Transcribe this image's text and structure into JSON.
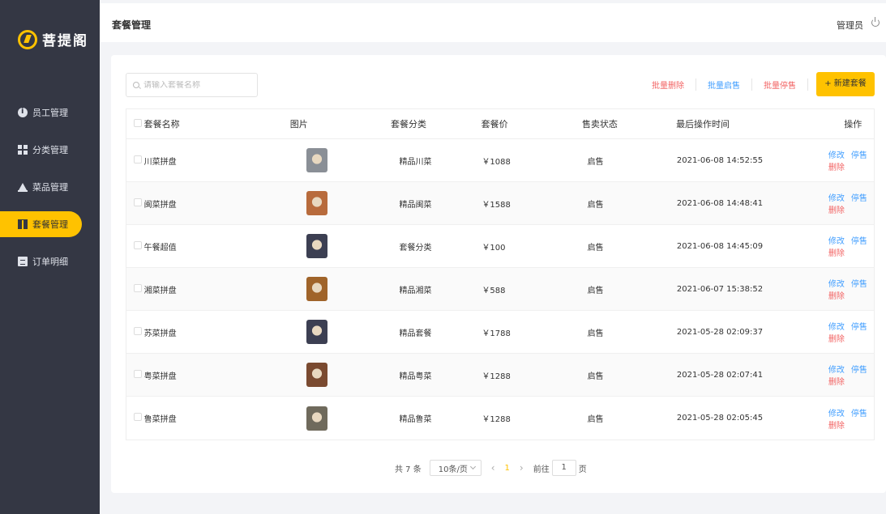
{
  "brand": {
    "name": "菩提阁",
    "logo_icon": "bodhi-logo-icon"
  },
  "sidebar": {
    "items": [
      {
        "label": "员工管理",
        "icon": "info-icon",
        "active": false
      },
      {
        "label": "分类管理",
        "icon": "grid-icon",
        "active": false
      },
      {
        "label": "菜品管理",
        "icon": "bell-icon",
        "active": false
      },
      {
        "label": "套餐管理",
        "icon": "gift-icon",
        "active": true
      },
      {
        "label": "订单明细",
        "icon": "document-icon",
        "active": false
      }
    ]
  },
  "header": {
    "title": "套餐管理",
    "user": "管理员",
    "power_icon": "power-icon"
  },
  "toolbar": {
    "search_placeholder": "请输入套餐名称",
    "batch_delete": "批量删除",
    "batch_enable": "批量启售",
    "batch_disable": "批量停售",
    "new_button": "+ 新建套餐"
  },
  "table": {
    "columns": [
      "套餐名称",
      "图片",
      "套餐分类",
      "套餐价",
      "售卖状态",
      "最后操作时间",
      "操作"
    ],
    "rows": [
      {
        "name": "川菜拼盘",
        "category": "精品川菜",
        "price": "￥1088",
        "status": "启售",
        "time": "2021-06-08 14:52:55",
        "thumb": "#8a8f96"
      },
      {
        "name": "闽菜拼盘",
        "category": "精品闽菜",
        "price": "￥1588",
        "status": "启售",
        "time": "2021-06-08 14:48:41",
        "thumb": "#b86b3c"
      },
      {
        "name": "午餐超值",
        "category": "套餐分类",
        "price": "￥100",
        "status": "启售",
        "time": "2021-06-08 14:45:09",
        "thumb": "#3c3f52"
      },
      {
        "name": "湘菜拼盘",
        "category": "精品湘菜",
        "price": "￥588",
        "status": "启售",
        "time": "2021-06-07 15:38:52",
        "thumb": "#a0642a"
      },
      {
        "name": "苏菜拼盘",
        "category": "精品套餐",
        "price": "￥1788",
        "status": "启售",
        "time": "2021-05-28 02:09:37",
        "thumb": "#3c3f52"
      },
      {
        "name": "粤菜拼盘",
        "category": "精品粤菜",
        "price": "￥1288",
        "status": "启售",
        "time": "2021-05-28 02:07:41",
        "thumb": "#7a4a30"
      },
      {
        "name": "鲁菜拼盘",
        "category": "精品鲁菜",
        "price": "￥1288",
        "status": "启售",
        "time": "2021-05-28 02:05:45",
        "thumb": "#6f6a5c"
      }
    ],
    "op_edit": "修改",
    "op_disable": "停售",
    "op_delete": "删除"
  },
  "pagination": {
    "total": "共 7 条",
    "page_size": "10条/页",
    "current": "1",
    "goto_label": "前往",
    "goto_value": "1",
    "page_suffix": "页"
  },
  "colors": {
    "accent": "#ffc200",
    "sidebar": "#343744",
    "link_blue": "#419eff",
    "link_red": "#f26464"
  }
}
